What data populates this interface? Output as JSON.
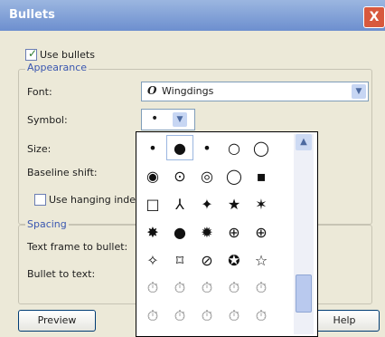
{
  "window": {
    "title": "Bullets",
    "close_label": "X"
  },
  "use_bullets": {
    "label": "Use bullets",
    "checked": true
  },
  "appearance": {
    "legend": "Appearance",
    "font_label": "Font:",
    "font_value": "Wingdings",
    "symbol_label": "Symbol:",
    "symbol_value": "•",
    "size_label": "Size:",
    "baseline_label": "Baseline shift:",
    "hanging_label": "Use hanging indent",
    "hanging_checked": false
  },
  "spacing": {
    "legend": "Spacing",
    "text_frame_label": "Text frame to bullet:",
    "bullet_to_text_label": "Bullet to text:"
  },
  "symbols": [
    [
      "•",
      "●",
      "•",
      "○",
      "◯"
    ],
    [
      "◉",
      "⊙",
      "◎",
      "◯",
      "▪"
    ],
    [
      "□",
      "⅄",
      "✦",
      "★",
      "✶"
    ],
    [
      "✸",
      "●",
      "✹",
      "⊕",
      "⊕"
    ],
    [
      "✧",
      "⌑",
      "⊘",
      "✪",
      "☆"
    ],
    [
      "⏱",
      "⏱",
      "⏱",
      "⏱",
      "⏱"
    ],
    [
      "⏱",
      "⏱",
      "⏱",
      "⏱",
      "⏱"
    ]
  ],
  "buttons": {
    "preview": "Preview",
    "help": "Help"
  },
  "icons": {
    "dropdown": "chevron-down-icon",
    "scroll_up": "chevron-up-icon",
    "close": "close-icon",
    "font": "font-icon"
  }
}
